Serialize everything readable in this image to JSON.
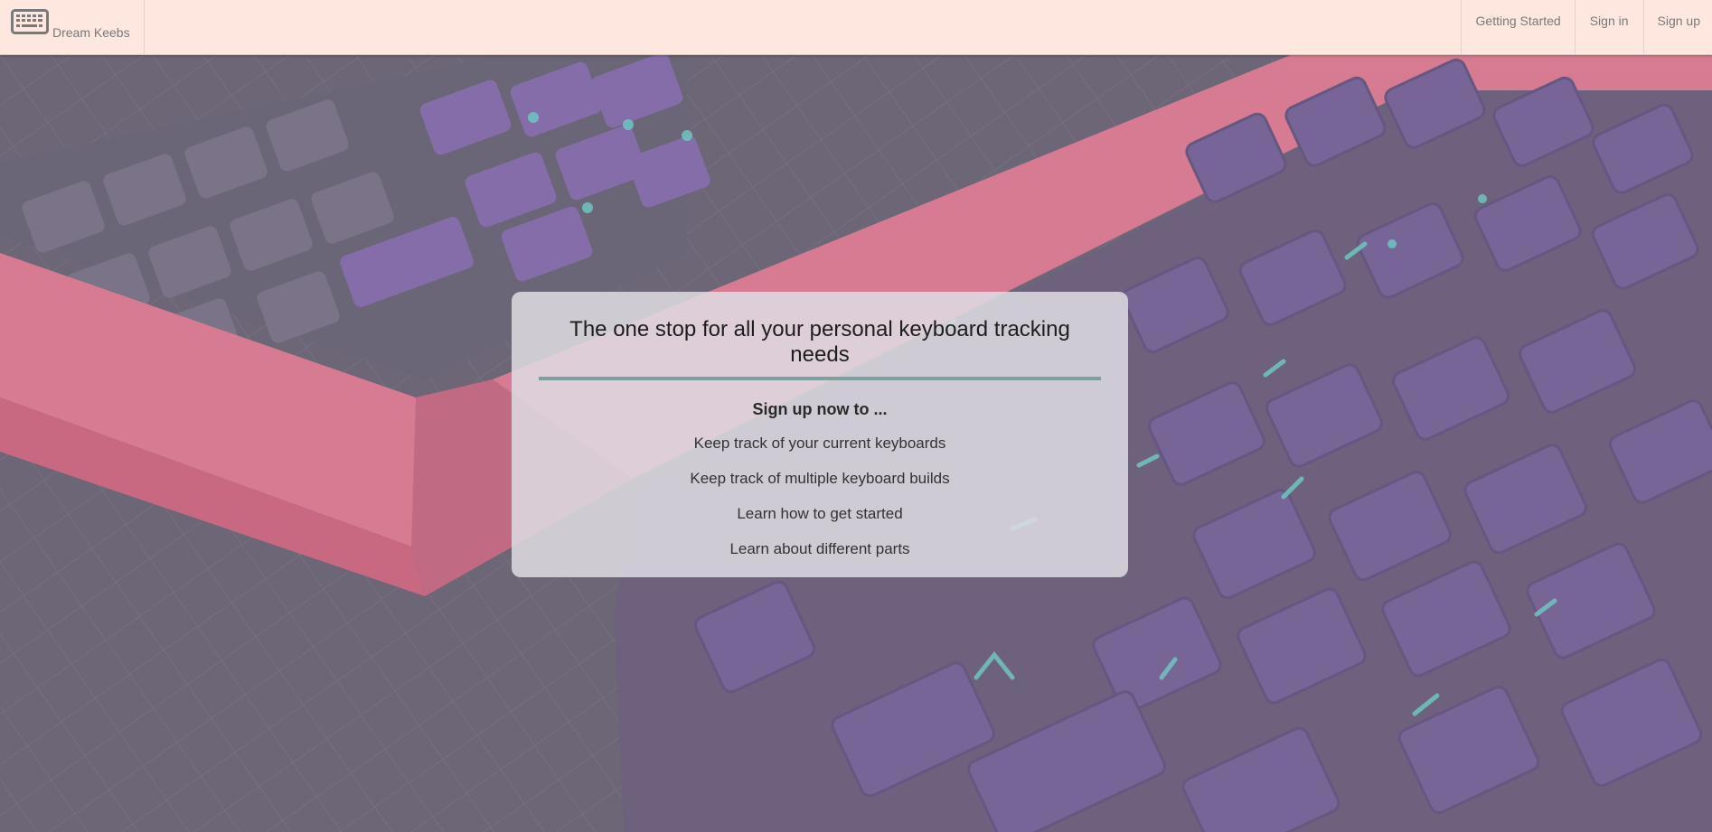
{
  "navbar": {
    "brand_label": "Dream Keebs",
    "links": {
      "getting_started": "Getting Started",
      "sign_in": "Sign in",
      "sign_up": "Sign up"
    }
  },
  "hero_card": {
    "title": "The one stop for all your personal keyboard tracking needs",
    "subtitle": "Sign up now to ...",
    "features": [
      "Keep track of your current keyboards",
      "Keep track of multiple keyboard builds",
      "Learn how to get started",
      "Learn about different parts"
    ]
  },
  "icons": {
    "brand": "keyboard-icon"
  },
  "colors": {
    "navbar_bg": "#fde7df",
    "card_bg": "#dedce2",
    "title_underline": "#7f9ea0",
    "keyboard_case": "#e8768f",
    "keycap_purple": "#6f5f96",
    "legend_teal": "#5fd0c8"
  }
}
